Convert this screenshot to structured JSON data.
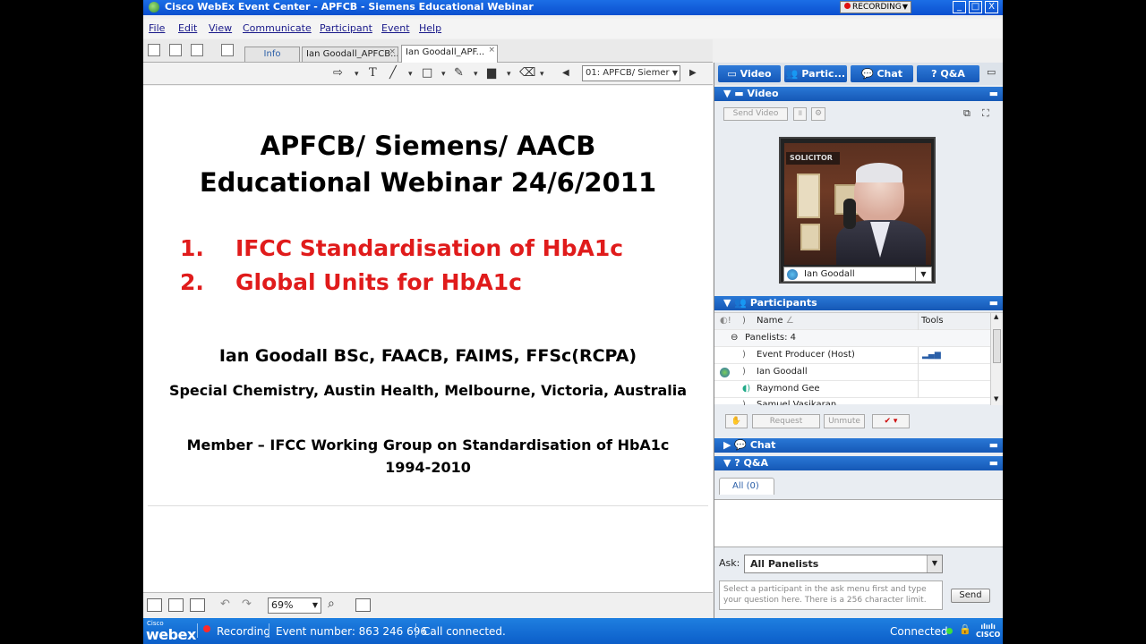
{
  "window": {
    "title": "Cisco WebEx Event Center - APFCB - Siemens Educational Webinar",
    "recording_label": "RECORDING",
    "minimize": "_",
    "maximize": "□",
    "close": "X"
  },
  "menu": [
    "File",
    "Edit",
    "View",
    "Communicate",
    "Participant",
    "Event",
    "Help"
  ],
  "doc_tabs": [
    {
      "label": "Info"
    },
    {
      "label": "Ian Goodall_APFCB..."
    },
    {
      "label": "Ian Goodall_APF..."
    }
  ],
  "annotation": {
    "slide_selector": "01: APFCB/ Siemer"
  },
  "slide": {
    "title_line1": "APFCB/ Siemens/ AACB",
    "title_line2": "Educational Webinar  24/6/2011",
    "items": [
      {
        "num": "1.",
        "text": "IFCC Standardisation of HbA1c"
      },
      {
        "num": "2.",
        "text": "Global Units for HbA1c"
      }
    ],
    "author": "Ian Goodall BSc, FAACB, FAIMS, FFSc(RCPA)",
    "affiliation": "Special Chemistry, Austin Health, Melbourne, Victoria, Australia",
    "member": "Member – IFCC Working Group on Standardisation of HbA1c",
    "years": "1994-2010"
  },
  "bottom_toolbar": {
    "zoom": "69%"
  },
  "status": {
    "brand_small": "Cisco",
    "brand": "webex",
    "recording": "Recording",
    "event_number": "Event number: 863 246 696",
    "call": "Call connected.",
    "connected": "Connected",
    "cisco": "CISCO"
  },
  "panel_tabs": [
    "Video",
    "Partic...",
    "Chat",
    "Q&A"
  ],
  "video": {
    "header": "Video",
    "send_video": "Send Video",
    "presenter_name": "Ian Goodall",
    "poster_text": "SOLICITOR"
  },
  "participants": {
    "header": "Participants",
    "col_name": "Name",
    "col_tools": "Tools",
    "group": "Panelists: 4",
    "rows": [
      "Event Producer (Host)",
      "Ian Goodall",
      "Raymond Gee",
      "Samuel Vasikaran"
    ],
    "request": "Request",
    "unmute": "Unmute"
  },
  "chat": {
    "header": "Chat"
  },
  "qa": {
    "header": "Q&A",
    "tab": "All (0)",
    "ask_label": "Ask:",
    "ask_value": "All Panelists",
    "placeholder": "Select a participant in the ask menu first and type your question here. There is a 256 character limit.",
    "send": "Send"
  },
  "colors": {
    "accent": "#1558b6",
    "slide_red": "#e01b1b",
    "status_bar": "#0b5ec9"
  }
}
